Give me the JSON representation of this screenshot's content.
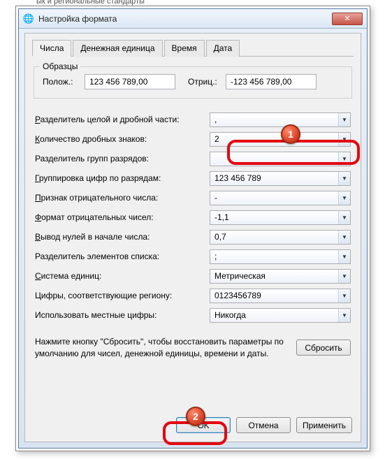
{
  "partial_bg_text": "ык и региональные стандарты",
  "window": {
    "title": "Настройка формата"
  },
  "tabs": {
    "numbers": "Числа",
    "currency": "Денежная единица",
    "time": "Время",
    "date": "Дата"
  },
  "samples": {
    "legend": "Образцы",
    "positive_label": "Полож.:",
    "positive_value": "123 456 789,00",
    "negative_label": "Отриц.:",
    "negative_value": "-123 456 789,00"
  },
  "settings": {
    "decimal_sep": {
      "label": "Разделитель целой и дробной части:",
      "value": ","
    },
    "decimal_digits": {
      "label": "Количество дробных знаков:",
      "value": "2"
    },
    "group_sep": {
      "label": "Разделитель групп разрядов:",
      "value": ""
    },
    "grouping": {
      "label": "Группировка цифр по разрядам:",
      "value": "123 456 789"
    },
    "neg_sign": {
      "label": "Признак отрицательного числа:",
      "value": "-"
    },
    "neg_format": {
      "label": "Формат отрицательных чисел:",
      "value": "-1,1"
    },
    "leading_zero": {
      "label": "Вывод нулей в начале числа:",
      "value": "0,7"
    },
    "list_sep": {
      "label": "Разделитель элементов списка:",
      "value": ";"
    },
    "measure": {
      "label": "Система единиц:",
      "value": "Метрическая"
    },
    "native_digits": {
      "label": "Цифры, соответствующие региону:",
      "value": "0123456789"
    },
    "digit_sub": {
      "label": "Использовать местные цифры:",
      "value": "Никогда"
    }
  },
  "reset": {
    "text": "Нажмите кнопку \"Сбросить\", чтобы восстановить параметры по умолчанию для чисел, денежной единицы, времени и даты.",
    "button": "Сбросить"
  },
  "buttons": {
    "ok": "OK",
    "cancel": "Отмена",
    "apply": "Применить"
  },
  "callouts": {
    "one": "1",
    "two": "2"
  }
}
